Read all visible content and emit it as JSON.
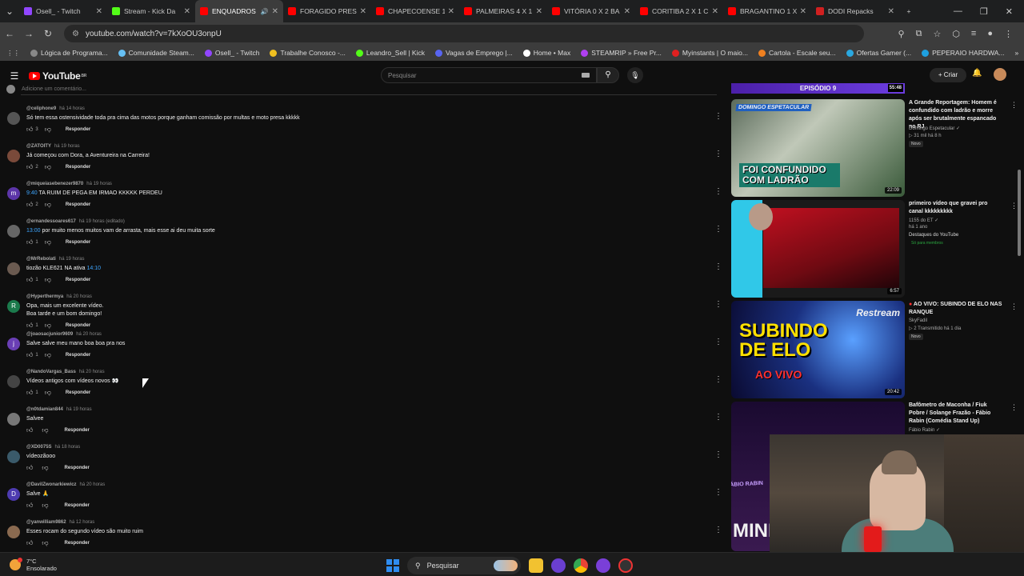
{
  "browser": {
    "tabs": [
      {
        "label": "Osell_ - Twitch",
        "color": "#9146ff",
        "active": false
      },
      {
        "label": "Stream - Kick Da",
        "color": "#53fc18",
        "active": false
      },
      {
        "label": "ENQUADROS",
        "color": "#ff0000",
        "active": true
      },
      {
        "label": "FORAGIDO PRESO",
        "color": "#ff0000",
        "active": false
      },
      {
        "label": "CHAPECOENSE 1",
        "color": "#ff0000",
        "active": false
      },
      {
        "label": "PALMEIRAS 4 X 1",
        "color": "#ff0000",
        "active": false
      },
      {
        "label": "VITÓRIA 0 X 2 BA",
        "color": "#ff0000",
        "active": false
      },
      {
        "label": "CORITIBA 2 X 1 C",
        "color": "#ff0000",
        "active": false
      },
      {
        "label": "BRAGANTINO 1 X",
        "color": "#ff0000",
        "active": false
      },
      {
        "label": "DODI Repacks",
        "color": "#d02020",
        "active": false
      }
    ],
    "new_tab": "+",
    "url": "youtube.com/watch?v=7kXoOU3onpU",
    "bookmarks": [
      {
        "label": "Lógica de Programa...",
        "color": "#888888"
      },
      {
        "label": "Comunidade Steam...",
        "color": "#66c0f4"
      },
      {
        "label": "Osell_ - Twitch",
        "color": "#9146ff"
      },
      {
        "label": "Trabalhe Conosco -...",
        "color": "#f0c020"
      },
      {
        "label": "Leandro_Sell | Kick",
        "color": "#53fc18"
      },
      {
        "label": "Vagas de Emprego |...",
        "color": "#5865f2"
      },
      {
        "label": "Home • Max",
        "color": "#ffffff"
      },
      {
        "label": "STEAMRIP » Free Pr...",
        "color": "#b040f0"
      },
      {
        "label": "Myinstants | O maio...",
        "color": "#e02020"
      },
      {
        "label": "Cartola - Escale seu...",
        "color": "#f08020"
      },
      {
        "label": "Ofertas Gamer (...",
        "color": "#2aa8e0"
      },
      {
        "label": "PEPERAIO HARDWA...",
        "color": "#1ea0e0"
      }
    ]
  },
  "youtube": {
    "logo": "YouTube",
    "region": "BR",
    "search_placeholder": "Pesquisar",
    "create_label": "+ Criar",
    "add_comment": "Adicione um comentário..."
  },
  "comments": [
    {
      "handle": "@celiphone9",
      "time": "há 14 horas",
      "text": "Só tem essa ostensividade toda pra cima das motos porque ganham comissão por multas e moto presa kkkkk",
      "likes": "3",
      "avatar_color": "#555555",
      "avatar_letter": ""
    },
    {
      "handle": "@ZATOITY",
      "time": "há 19 horas",
      "text": "Já começou com Dora, a Aventureira na Carreira!",
      "likes": "2",
      "avatar_color": "#7a4a3a",
      "avatar_letter": ""
    },
    {
      "handle": "@miqueiasebenezer9870",
      "time": "há 19 horas",
      "ts": "9:40",
      "text": "TA RUIM DE PEGA EM IRMAO KKKKK PERDEU",
      "likes": "2",
      "avatar_color": "#5c35a8",
      "avatar_letter": "m"
    },
    {
      "handle": "@ernandessoares617",
      "time": "há 19 horas (editado)",
      "ts": "13:00",
      "text": "por muito menos muitos vam de arrasta, mais esse ai deu muita sorte",
      "likes": "1",
      "avatar_color": "#666666",
      "avatar_letter": ""
    },
    {
      "handle": "@MrRebolati",
      "time": "há 19 horas",
      "text": "tiozão KLE621 NA ativa",
      "ts_after": "14:10",
      "likes": "1",
      "avatar_color": "#6a5a50",
      "avatar_letter": ""
    },
    {
      "handle": "@Hyperthermya",
      "time": "há 20 horas",
      "text": "Opa, mais um excelente vídeo.",
      "text2": "Boa tarde e um bom domingo!",
      "likes": "1",
      "avatar_color": "#1b7a4c",
      "avatar_letter": "R"
    },
    {
      "handle": "@joaosacjunior9609",
      "time": "há 20 horas",
      "text": "Salve salve meu mano boa boa pra nos",
      "likes": "1",
      "avatar_color": "#6a3fb5",
      "avatar_letter": "j"
    },
    {
      "handle": "@NandoVargas_Bass",
      "time": "há 20 horas",
      "text": "Vídeos antigos com vídeos novos 👀",
      "likes": "1",
      "avatar_color": "#444444",
      "avatar_letter": ""
    },
    {
      "handle": "@n0tdamian844",
      "time": "há 19 horas",
      "text": "Salvee",
      "likes": "",
      "avatar_color": "#777777",
      "avatar_letter": ""
    },
    {
      "handle": "@XD0075S",
      "time": "há 18 horas",
      "text": "vídeozãooo",
      "likes": "",
      "avatar_color": "#3a5a6a",
      "avatar_letter": ""
    },
    {
      "handle": "@DavilZwonarkiewicz",
      "time": "há 20 horas",
      "text": "Salve 🙏",
      "likes": "",
      "avatar_color": "#4d3bb0",
      "avatar_letter": "D"
    },
    {
      "handle": "@yanwilliam9862",
      "time": "há 12 horas",
      "text": "Esses rocam do segundo vídeo são muito ruim",
      "likes": "",
      "avatar_color": "#8a6a50",
      "avatar_letter": ""
    }
  ],
  "reply_label": "Responder",
  "related": {
    "top_banner": "EPISÓDIO 9",
    "top_banner_dur": "55:48",
    "videos": [
      {
        "title": "A Grande Reportagem: Homem é confundido com ladrão e morre após ser brutalmente espancado no RJ",
        "channel": "Domingo Espetacular ✓",
        "meta": "▷ 31 mil  há 8 h",
        "badge": "Novo",
        "duration": "22:09",
        "thumb_text": "FOI CONFUNDIDO COM LADRÃO",
        "thumb_top": "DOMINGO ESPETACULAR"
      },
      {
        "title": "primeiro vídeo que gravei pro canal kkkkkkkkk",
        "channel": "1155 do ET ✓",
        "meta": "há 1 ano",
        "badge": "Destaques do YouTube",
        "badge2": "Só para membros",
        "duration": "6:57"
      },
      {
        "title": "AO VIVO: SUBINDO DE ELO NAS RANQUE",
        "channel": "SkyFadil",
        "meta": "▷ 2  Transmitido há 1 dia",
        "badge": "Novo",
        "duration": "20:42",
        "thumb_text": "SUBINDO DE ELO",
        "thumb_sub": "AO VIVO",
        "thumb_corner": "Restream"
      },
      {
        "title": "Bafômetro de Maconha / Fiuk Pobre / Solange Frazão - Fábio Rabin (Comédia Stand Up)",
        "channel": "Fábio Rabin ✓",
        "thumb_text": "FÁBIO RABIN",
        "thumb_big": "MINH"
      }
    ]
  },
  "taskbar": {
    "temp": "7°C",
    "weather": "Ensolarado",
    "search": "Pesquisar"
  }
}
